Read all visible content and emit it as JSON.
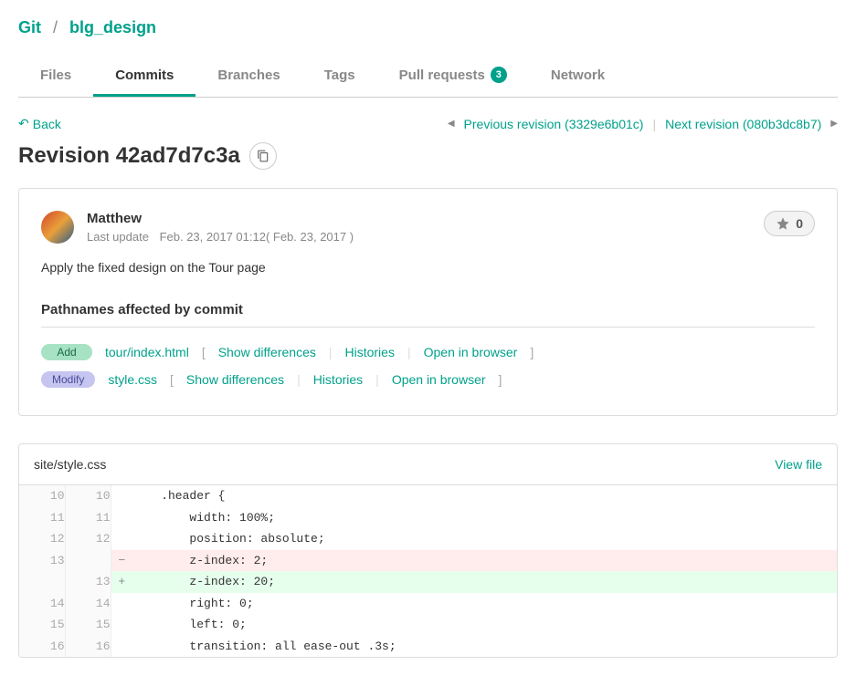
{
  "breadcrumb": {
    "root": "Git",
    "repo": "blg_design"
  },
  "tabs": {
    "files": "Files",
    "commits": "Commits",
    "branches": "Branches",
    "tags": "Tags",
    "pull_requests": "Pull requests",
    "pull_requests_count": "3",
    "network": "Network"
  },
  "nav": {
    "back": "Back",
    "prev": "Previous revision (3329e6b01c)",
    "next": "Next revision (080b3dc8b7)"
  },
  "title": "Revision 42ad7d7c3a",
  "commit": {
    "author": "Matthew",
    "last_update_label": "Last update",
    "date": "Feb. 23, 2017 01:12( Feb. 23, 2017 )",
    "message": "Apply the fixed design on the Tour page",
    "stars": "0"
  },
  "pathnames": {
    "title": "Pathnames affected by commit",
    "actions": {
      "show_diff": "Show differences",
      "histories": "Histories",
      "open": "Open in browser"
    },
    "rows": [
      {
        "type": "Add",
        "type_class": "add",
        "file": "tour/index.html"
      },
      {
        "type": "Modify",
        "type_class": "modify",
        "file": "style.css"
      }
    ]
  },
  "diff": {
    "filepath": "site/style.css",
    "view_file": "View file",
    "lines": [
      {
        "old": "10",
        "new": "10",
        "sign": "",
        "css": "",
        "code": "    .header {"
      },
      {
        "old": "11",
        "new": "11",
        "sign": "",
        "css": "",
        "code": "        width: 100%;"
      },
      {
        "old": "12",
        "new": "12",
        "sign": "",
        "css": "",
        "code": "        position: absolute;"
      },
      {
        "old": "13",
        "new": "",
        "sign": "−",
        "css": "line-del",
        "code": "        z-index: 2;"
      },
      {
        "old": "",
        "new": "13",
        "sign": "+",
        "css": "line-add",
        "code": "        z-index: 20;"
      },
      {
        "old": "14",
        "new": "14",
        "sign": "",
        "css": "",
        "code": "        right: 0;"
      },
      {
        "old": "15",
        "new": "15",
        "sign": "",
        "css": "",
        "code": "        left: 0;"
      },
      {
        "old": "16",
        "new": "16",
        "sign": "",
        "css": "",
        "code": "        transition: all ease-out .3s;"
      }
    ]
  }
}
